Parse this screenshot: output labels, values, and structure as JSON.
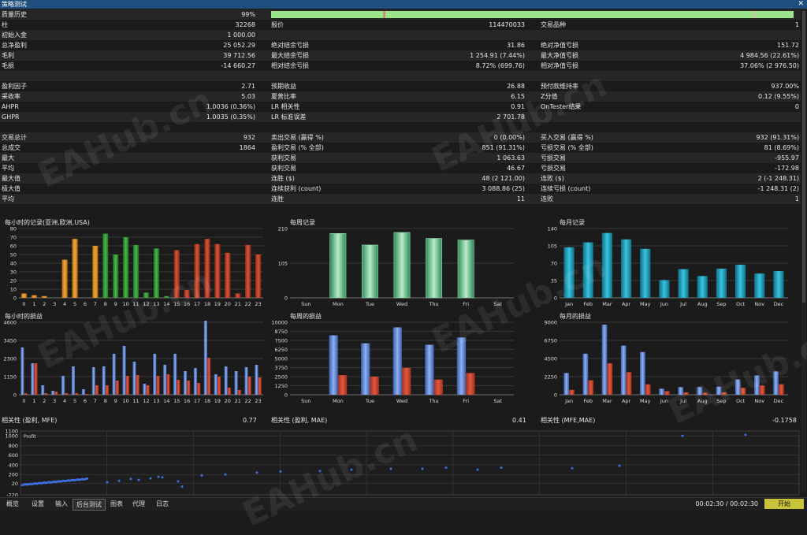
{
  "window": {
    "title": "策略测试"
  },
  "stats": {
    "quality_label": "质量历史",
    "quality_value": "99%",
    "quality_fraction": 0.99,
    "rows": [
      [
        "柱",
        "32268",
        "报价",
        "114470033",
        "交易品种",
        "1"
      ],
      [
        "初始入金",
        "1 000.00",
        "",
        "",
        "",
        ""
      ],
      [
        "总净盈利",
        "25 052.29",
        "绝对结余亏损",
        "31.86",
        "绝对净值亏损",
        "151.72"
      ],
      [
        "毛利",
        "39 712.56",
        "最大结余亏损",
        "1 254.91 (7.44%)",
        "最大净值亏损",
        "4 984.56 (22.61%)"
      ],
      [
        "毛损",
        "-14 660.27",
        "相对结余亏损",
        "8.72% (699.76)",
        "相对净值亏损",
        "37.06% (2 976.50)"
      ],
      [
        "",
        "",
        "",
        "",
        "",
        ""
      ],
      [
        "盈利因子",
        "2.71",
        "预期收益",
        "26.88",
        "预付款维持率",
        "937.00%"
      ],
      [
        "采收率",
        "5.03",
        "夏普比率",
        "6.15",
        "Z分值",
        "0.12 (9.55%)"
      ],
      [
        "AHPR",
        "1.0036 (0.36%)",
        "LR 相关性",
        "0.91",
        "OnTester结果",
        "0"
      ],
      [
        "GHPR",
        "1.0035 (0.35%)",
        "LR 标准误差",
        "2 701.78",
        "",
        ""
      ],
      [
        "",
        "",
        "",
        "",
        "",
        ""
      ],
      [
        "交易总计",
        "932",
        "卖出交易 (赢得 %)",
        "0 (0.00%)",
        "买入交易 (赢得 %)",
        "932 (91.31%)"
      ],
      [
        "总成交",
        "1864",
        "盈利交易 (% 全部)",
        "851 (91.31%)",
        "亏损交易 (% 全部)",
        "81 (8.69%)"
      ],
      [
        "最大",
        "",
        "获利交易",
        "1 063.63",
        "亏损交易",
        "-955.97"
      ],
      [
        "平均",
        "",
        "获利交易",
        "46.67",
        "亏损交易",
        "-172.98"
      ],
      [
        "最大值",
        "",
        "连胜 ($)",
        "48 (2 121.00)",
        "连败 ($)",
        "2 (-1 248.31)"
      ],
      [
        "极大值",
        "",
        "连续获利 (count)",
        "3 088.86 (25)",
        "连续亏损 (count)",
        "-1 248.31 (2)"
      ],
      [
        "平均",
        "",
        "连胜",
        "11",
        "连败",
        "1"
      ]
    ]
  },
  "chart_data": [
    {
      "type": "bar",
      "title": "每小时的记录(亚洲,欧洲,USA)",
      "categories": [
        "0",
        "1",
        "2",
        "3",
        "4",
        "5",
        "6",
        "7",
        "8",
        "9",
        "10",
        "11",
        "12",
        "13",
        "14",
        "15",
        "16",
        "17",
        "18",
        "19",
        "20",
        "21",
        "22",
        "23"
      ],
      "values": [
        5,
        3,
        2,
        0,
        44,
        68,
        0,
        60,
        74,
        50,
        70,
        61,
        6,
        57,
        2,
        55,
        9,
        62,
        68,
        62,
        52,
        5,
        61,
        50
      ],
      "ylim": [
        0,
        80
      ],
      "yticks": [
        0,
        10,
        20,
        30,
        40,
        50,
        60,
        70,
        80
      ]
    },
    {
      "type": "bar",
      "title": "每周记录",
      "categories": [
        "Sun",
        "Mon",
        "Tue",
        "Wed",
        "Thu",
        "Fri",
        "Sat"
      ],
      "values": [
        0,
        195,
        160,
        198,
        180,
        175,
        0
      ],
      "ylim": [
        0,
        210
      ],
      "yticks": [
        0,
        105,
        210
      ]
    },
    {
      "type": "bar",
      "title": "每月记录",
      "categories": [
        "Jan",
        "Feb",
        "Mar",
        "Apr",
        "May",
        "Jun",
        "Jul",
        "Aug",
        "Sep",
        "Oct",
        "Nov",
        "Dec"
      ],
      "values": [
        102,
        112,
        131,
        118,
        99,
        36,
        58,
        44,
        59,
        67,
        49,
        54
      ],
      "ylim": [
        0,
        140
      ],
      "yticks": [
        0,
        35,
        70,
        105,
        140
      ]
    },
    {
      "type": "bar",
      "title": "每小时的损益",
      "categories": [
        "0",
        "1",
        "2",
        "3",
        "4",
        "5",
        "6",
        "7",
        "8",
        "9",
        "10",
        "11",
        "12",
        "13",
        "14",
        "15",
        "16",
        "17",
        "18",
        "19",
        "20",
        "21",
        "22",
        "23"
      ],
      "series": [
        {
          "values": [
            3000,
            2000,
            600,
            250,
            1200,
            1800,
            350,
            1750,
            1800,
            2600,
            3100,
            2100,
            700,
            2600,
            1900,
            2600,
            1500,
            1700,
            4700,
            1300,
            1800,
            1500,
            1750,
            1900
          ]
        },
        {
          "values": [
            100,
            2000,
            100,
            200,
            100,
            100,
            50,
            600,
            600,
            900,
            1200,
            1250,
            600,
            1200,
            1300,
            950,
            900,
            750,
            2350,
            1150,
            450,
            300,
            1150,
            1100
          ]
        }
      ],
      "ylim": [
        0,
        4600
      ],
      "yticks": [
        0,
        1150,
        2300,
        3450,
        4600
      ]
    },
    {
      "type": "bar",
      "title": "每周的损益",
      "categories": [
        "Sun",
        "Mon",
        "Tue",
        "Wed",
        "Thu",
        "Fri",
        "Sat"
      ],
      "series": [
        {
          "values": [
            0,
            8200,
            7100,
            9300,
            6900,
            7900,
            0
          ]
        },
        {
          "values": [
            0,
            2700,
            2500,
            3700,
            2100,
            3000,
            0
          ]
        }
      ],
      "ylim": [
        0,
        10000
      ],
      "yticks": [
        0,
        1250,
        2500,
        3750,
        5000,
        6250,
        7500,
        8750,
        10000
      ]
    },
    {
      "type": "bar",
      "title": "每月的损益",
      "categories": [
        "Jan",
        "Feb",
        "Mar",
        "Apr",
        "May",
        "Jun",
        "Jul",
        "Aug",
        "Sep",
        "Oct",
        "Nov",
        "Dec"
      ],
      "series": [
        {
          "values": [
            2700,
            5100,
            8700,
            6100,
            5300,
            750,
            950,
            950,
            1000,
            1900,
            2400,
            2900
          ]
        },
        {
          "values": [
            600,
            1800,
            3900,
            2800,
            1300,
            450,
            300,
            250,
            300,
            850,
            1150,
            1300
          ]
        }
      ],
      "ylim": [
        0,
        9000
      ],
      "yticks": [
        0,
        2250,
        4500,
        6750,
        9000
      ]
    },
    {
      "type": "scatter",
      "title": "",
      "series": [
        {
          "name": "Profit"
        }
      ],
      "ylim": [
        -220,
        1100
      ],
      "yticks": [
        -220,
        20,
        200,
        400,
        600,
        800,
        1000,
        1100
      ]
    }
  ],
  "correlation": {
    "c1_label": "相关性 (盈利, MFE)",
    "c1_value": "0.77",
    "c2_label": "相关性 (盈利, MAE)",
    "c2_value": "0.41",
    "c3_label": "相关性 (MFE,MAE)",
    "c3_value": "-0.1758"
  },
  "bottom": {
    "tabs": [
      "概览",
      "设置",
      "输入",
      "后台测试",
      "图表",
      "代理",
      "日志"
    ],
    "active_tab": "后台测试",
    "timer": "00:02:30 / 00:02:30",
    "start": "开始"
  },
  "watermark": "EAHub.cn"
}
